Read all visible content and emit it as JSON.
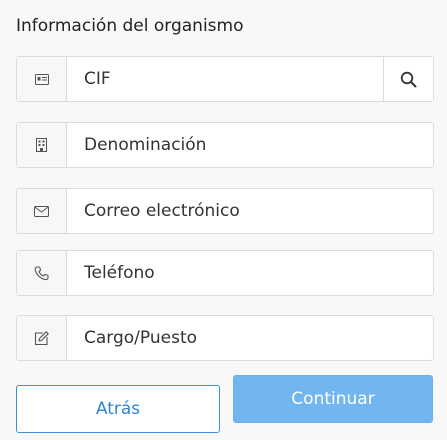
{
  "section": {
    "title": "Información del organismo"
  },
  "fields": [
    {
      "icon": "id-card-icon",
      "placeholder": "CIF"
    },
    {
      "icon": "building-icon",
      "placeholder": "Denominación"
    },
    {
      "icon": "envelope-icon",
      "placeholder": "Correo electrónico"
    },
    {
      "icon": "phone-icon",
      "placeholder": "Teléfono"
    },
    {
      "icon": "edit-icon",
      "placeholder": "Cargo/Puesto"
    }
  ],
  "search": {
    "icon": "search-icon"
  },
  "actions": {
    "back_label": "Atrás",
    "continue_label": "Continuar"
  },
  "colors": {
    "primary": "#2f85d0",
    "primary_light": "#72b6f0",
    "border": "#d9dde1"
  }
}
